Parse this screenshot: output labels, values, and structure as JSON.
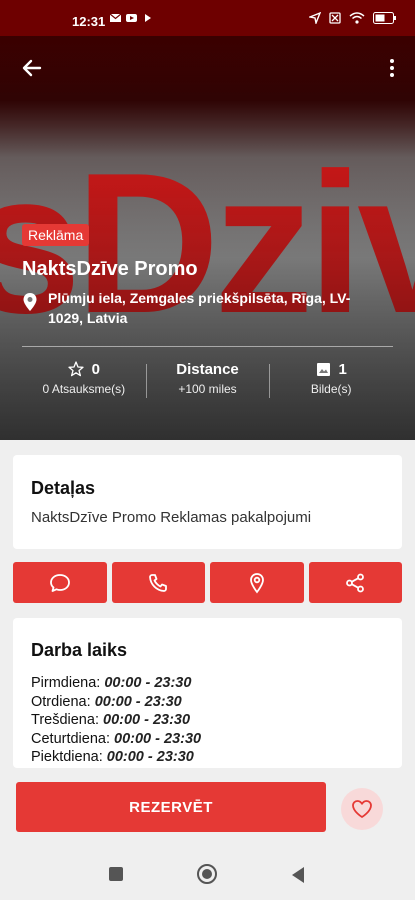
{
  "status_bar": {
    "time": "12:31"
  },
  "hero": {
    "background_text": "sDzive",
    "badge": "Reklāma",
    "title": "NaktsDzīve Promo",
    "address": "Plūmju iela, Zemgales priekšpilsēta, Rīga, LV-1029, Latvia",
    "stats": {
      "reviews": {
        "value": "0",
        "label": "0 Atsauksme(s)"
      },
      "distance": {
        "value": "Distance",
        "label": "+100 miles"
      },
      "photos": {
        "value": "1",
        "label": "Bilde(s)"
      }
    }
  },
  "details": {
    "heading": "Detaļas",
    "text": "NaktsDzīve Promo Reklamas pakalpojumi"
  },
  "actions": [
    {
      "icon": "chat-icon"
    },
    {
      "icon": "phone-icon"
    },
    {
      "icon": "location-pin-icon"
    },
    {
      "icon": "share-icon"
    }
  ],
  "hours": {
    "heading": "Darba laiks",
    "days": [
      {
        "day": "Pirmdiena:",
        "time": "00:00 - 23:30"
      },
      {
        "day": "Otrdiena:",
        "time": "00:00 - 23:30"
      },
      {
        "day": "Trešdiena:",
        "time": "00:00 - 23:30"
      },
      {
        "day": "Ceturtdiena:",
        "time": "00:00 - 23:30"
      },
      {
        "day": "Piektdiena:",
        "time": "00:00 - 23:30"
      }
    ]
  },
  "bottom": {
    "reserve_label": "REZERVĒT"
  },
  "colors": {
    "accent": "#e53935",
    "favorite_bg": "#f8d9d9"
  }
}
